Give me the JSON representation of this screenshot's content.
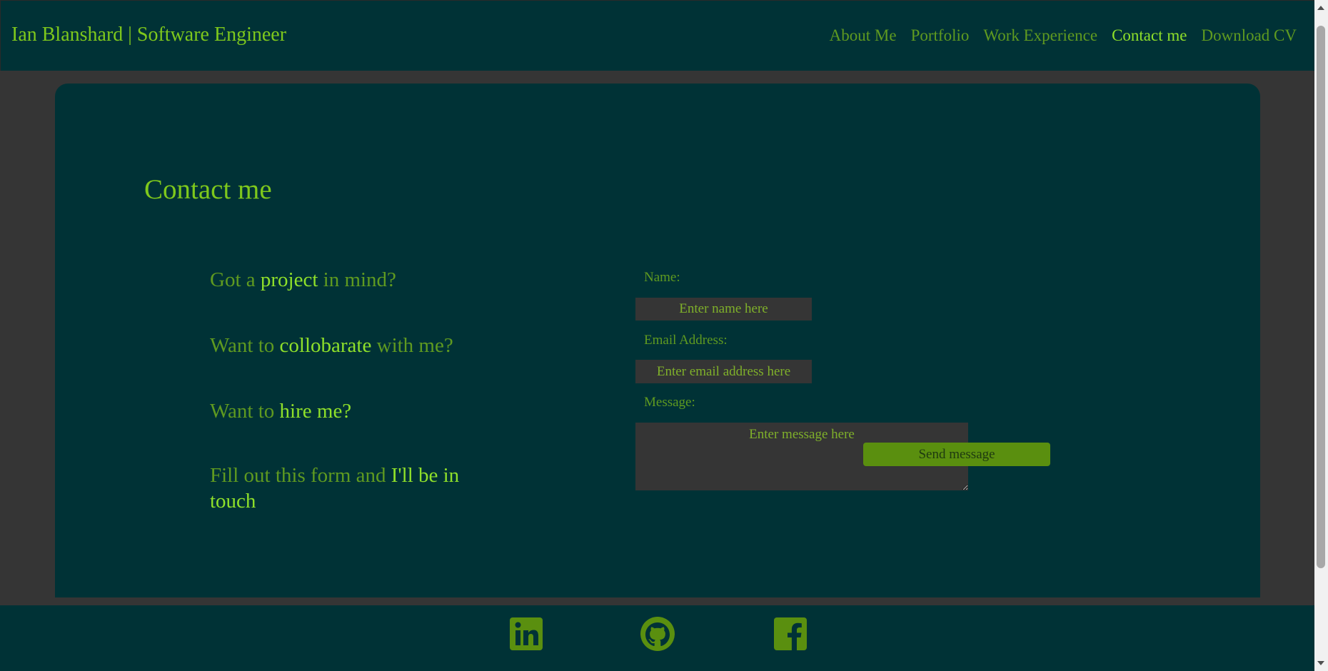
{
  "header": {
    "brand": "Ian Blanshard | Software Engineer",
    "nav": [
      {
        "label": "About Me",
        "active": false
      },
      {
        "label": "Portfolio",
        "active": false
      },
      {
        "label": "Work Experience",
        "active": false
      },
      {
        "label": "Contact me",
        "active": true
      },
      {
        "label": "Download CV",
        "active": false
      }
    ]
  },
  "main": {
    "title": "Contact me",
    "pitch": [
      {
        "pre": "Got a ",
        "highlight": "project",
        "post": " in mind?"
      },
      {
        "pre": "Want to ",
        "highlight": "collobarate",
        "post": " with me?"
      },
      {
        "pre": "Want to ",
        "highlight": "hire me?",
        "post": ""
      },
      {
        "pre": "Fill out this form and ",
        "highlight": "I'll be in touch",
        "post": ""
      }
    ],
    "form": {
      "name_label": "Name:",
      "name_placeholder": "Enter name here",
      "name_value": "",
      "email_label": "Email Address:",
      "email_placeholder": "Enter email address here",
      "email_value": "",
      "message_label": "Message:",
      "message_placeholder": "Enter message here",
      "message_value": "",
      "submit_label": "Send message"
    }
  },
  "footer": {
    "social": [
      {
        "icon": "linkedin-icon"
      },
      {
        "icon": "github-icon"
      },
      {
        "icon": "facebook-icon"
      }
    ]
  },
  "colors": {
    "background": "#353535",
    "panel": "#003236",
    "accent": "#7ec81c",
    "muted_green": "#5f9a20",
    "button": "#5a8f0f"
  }
}
